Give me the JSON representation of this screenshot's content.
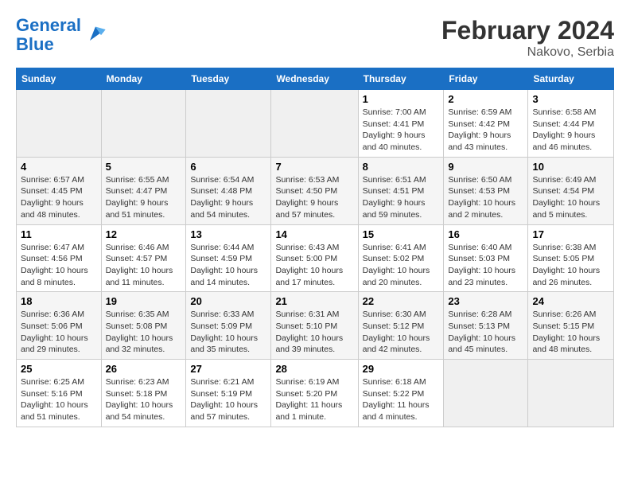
{
  "header": {
    "logo_line1": "General",
    "logo_line2": "Blue",
    "month_year": "February 2024",
    "location": "Nakovo, Serbia"
  },
  "days_of_week": [
    "Sunday",
    "Monday",
    "Tuesday",
    "Wednesday",
    "Thursday",
    "Friday",
    "Saturday"
  ],
  "weeks": [
    [
      {
        "day": "",
        "info": ""
      },
      {
        "day": "",
        "info": ""
      },
      {
        "day": "",
        "info": ""
      },
      {
        "day": "",
        "info": ""
      },
      {
        "day": "1",
        "info": "Sunrise: 7:00 AM\nSunset: 4:41 PM\nDaylight: 9 hours\nand 40 minutes."
      },
      {
        "day": "2",
        "info": "Sunrise: 6:59 AM\nSunset: 4:42 PM\nDaylight: 9 hours\nand 43 minutes."
      },
      {
        "day": "3",
        "info": "Sunrise: 6:58 AM\nSunset: 4:44 PM\nDaylight: 9 hours\nand 46 minutes."
      }
    ],
    [
      {
        "day": "4",
        "info": "Sunrise: 6:57 AM\nSunset: 4:45 PM\nDaylight: 9 hours\nand 48 minutes."
      },
      {
        "day": "5",
        "info": "Sunrise: 6:55 AM\nSunset: 4:47 PM\nDaylight: 9 hours\nand 51 minutes."
      },
      {
        "day": "6",
        "info": "Sunrise: 6:54 AM\nSunset: 4:48 PM\nDaylight: 9 hours\nand 54 minutes."
      },
      {
        "day": "7",
        "info": "Sunrise: 6:53 AM\nSunset: 4:50 PM\nDaylight: 9 hours\nand 57 minutes."
      },
      {
        "day": "8",
        "info": "Sunrise: 6:51 AM\nSunset: 4:51 PM\nDaylight: 9 hours\nand 59 minutes."
      },
      {
        "day": "9",
        "info": "Sunrise: 6:50 AM\nSunset: 4:53 PM\nDaylight: 10 hours\nand 2 minutes."
      },
      {
        "day": "10",
        "info": "Sunrise: 6:49 AM\nSunset: 4:54 PM\nDaylight: 10 hours\nand 5 minutes."
      }
    ],
    [
      {
        "day": "11",
        "info": "Sunrise: 6:47 AM\nSunset: 4:56 PM\nDaylight: 10 hours\nand 8 minutes."
      },
      {
        "day": "12",
        "info": "Sunrise: 6:46 AM\nSunset: 4:57 PM\nDaylight: 10 hours\nand 11 minutes."
      },
      {
        "day": "13",
        "info": "Sunrise: 6:44 AM\nSunset: 4:59 PM\nDaylight: 10 hours\nand 14 minutes."
      },
      {
        "day": "14",
        "info": "Sunrise: 6:43 AM\nSunset: 5:00 PM\nDaylight: 10 hours\nand 17 minutes."
      },
      {
        "day": "15",
        "info": "Sunrise: 6:41 AM\nSunset: 5:02 PM\nDaylight: 10 hours\nand 20 minutes."
      },
      {
        "day": "16",
        "info": "Sunrise: 6:40 AM\nSunset: 5:03 PM\nDaylight: 10 hours\nand 23 minutes."
      },
      {
        "day": "17",
        "info": "Sunrise: 6:38 AM\nSunset: 5:05 PM\nDaylight: 10 hours\nand 26 minutes."
      }
    ],
    [
      {
        "day": "18",
        "info": "Sunrise: 6:36 AM\nSunset: 5:06 PM\nDaylight: 10 hours\nand 29 minutes."
      },
      {
        "day": "19",
        "info": "Sunrise: 6:35 AM\nSunset: 5:08 PM\nDaylight: 10 hours\nand 32 minutes."
      },
      {
        "day": "20",
        "info": "Sunrise: 6:33 AM\nSunset: 5:09 PM\nDaylight: 10 hours\nand 35 minutes."
      },
      {
        "day": "21",
        "info": "Sunrise: 6:31 AM\nSunset: 5:10 PM\nDaylight: 10 hours\nand 39 minutes."
      },
      {
        "day": "22",
        "info": "Sunrise: 6:30 AM\nSunset: 5:12 PM\nDaylight: 10 hours\nand 42 minutes."
      },
      {
        "day": "23",
        "info": "Sunrise: 6:28 AM\nSunset: 5:13 PM\nDaylight: 10 hours\nand 45 minutes."
      },
      {
        "day": "24",
        "info": "Sunrise: 6:26 AM\nSunset: 5:15 PM\nDaylight: 10 hours\nand 48 minutes."
      }
    ],
    [
      {
        "day": "25",
        "info": "Sunrise: 6:25 AM\nSunset: 5:16 PM\nDaylight: 10 hours\nand 51 minutes."
      },
      {
        "day": "26",
        "info": "Sunrise: 6:23 AM\nSunset: 5:18 PM\nDaylight: 10 hours\nand 54 minutes."
      },
      {
        "day": "27",
        "info": "Sunrise: 6:21 AM\nSunset: 5:19 PM\nDaylight: 10 hours\nand 57 minutes."
      },
      {
        "day": "28",
        "info": "Sunrise: 6:19 AM\nSunset: 5:20 PM\nDaylight: 11 hours\nand 1 minute."
      },
      {
        "day": "29",
        "info": "Sunrise: 6:18 AM\nSunset: 5:22 PM\nDaylight: 11 hours\nand 4 minutes."
      },
      {
        "day": "",
        "info": ""
      },
      {
        "day": "",
        "info": ""
      }
    ]
  ]
}
